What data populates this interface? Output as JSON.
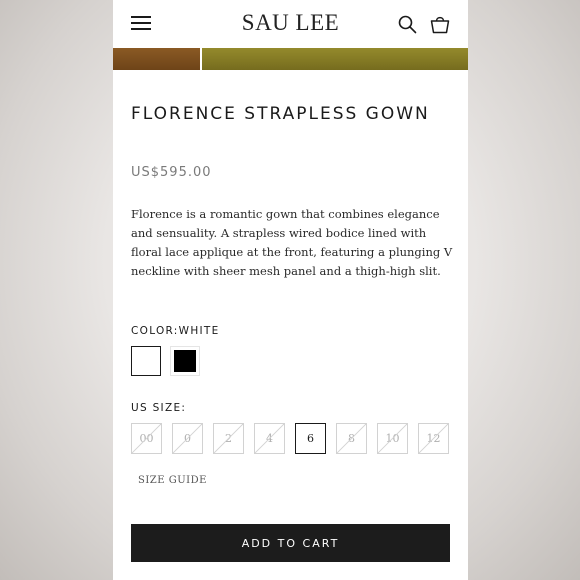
{
  "header": {
    "brand": "SAU LEE",
    "menu_icon": "hamburger-menu-icon",
    "search_icon": "search-icon",
    "cart_icon": "shopping-bag-icon"
  },
  "product": {
    "title": "FLORENCE STRAPLESS GOWN",
    "price": "US$595.00",
    "description": "Florence is a romantic gown that combines elegance and sensuality. A strapless wired bodice lined with floral lace applique at the front, featuring a plunging V neckline with sheer mesh panel and a thigh-high slit."
  },
  "color": {
    "label": "COLOR:WHITE",
    "options": [
      {
        "name": "White",
        "hex": "#ffffff",
        "selected": true
      },
      {
        "name": "Black",
        "hex": "#000000",
        "selected": false
      }
    ]
  },
  "size": {
    "label": "US SIZE:",
    "options": [
      {
        "label": "00",
        "available": false,
        "selected": false
      },
      {
        "label": "0",
        "available": false,
        "selected": false
      },
      {
        "label": "2",
        "available": false,
        "selected": false
      },
      {
        "label": "4",
        "available": false,
        "selected": false
      },
      {
        "label": "6",
        "available": true,
        "selected": true
      },
      {
        "label": "8",
        "available": false,
        "selected": false
      },
      {
        "label": "10",
        "available": false,
        "selected": false
      },
      {
        "label": "12",
        "available": false,
        "selected": false
      }
    ],
    "guide_label": "SIZE GUIDE"
  },
  "cart": {
    "add_label": "ADD TO CART"
  },
  "colors": {
    "button_bg": "#1c1c1c",
    "text_primary": "#1a1a1a",
    "price_text": "#7a7a7a",
    "unavailable": "#b0b0b0"
  }
}
